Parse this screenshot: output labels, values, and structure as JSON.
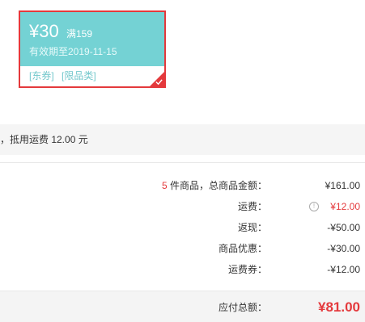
{
  "coupon": {
    "amount": "¥30",
    "condition": "满159",
    "validity": "有效期至2019-11-15",
    "tags": [
      "[东券]",
      "[限品类]"
    ],
    "selected": true,
    "colors": {
      "card": "#74d2d4",
      "border": "#e4393c"
    }
  },
  "freight": {
    "text": "，抵用运费 12.00 元"
  },
  "summary": {
    "items_count": "5",
    "items_label": " 件商品，总商品金额：",
    "items_value": "¥161.00",
    "shipping_label": "运费：",
    "shipping_value": "¥12.00",
    "shipping_icon": "info-icon",
    "cashback_label": "返现：",
    "cashback_value": "-¥50.00",
    "discount_label": "商品优惠：",
    "discount_value": "-¥30.00",
    "shipping_coupon_label": "运费券：",
    "shipping_coupon_value": "-¥12.00",
    "total_label": "应付总额：",
    "total_value": "¥81.00"
  }
}
